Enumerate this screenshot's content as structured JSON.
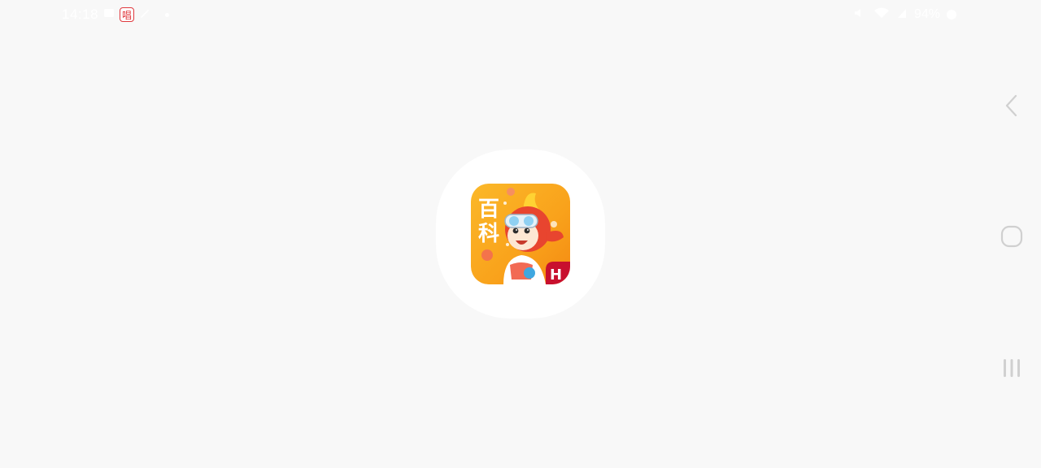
{
  "status_bar": {
    "time": "14:18",
    "notification_sing_glyph": "唱",
    "battery_percent": "94%"
  },
  "app_icon": {
    "title_line1": "百",
    "title_line2": "科",
    "badge": "H"
  },
  "colors": {
    "background": "#f8f8f8",
    "icon_orange": "#f9a21b",
    "badge_red": "#c8102e"
  },
  "icons": {
    "back": "chevron-left-icon",
    "home": "rounded-square-icon",
    "recents": "three-bars-icon"
  }
}
